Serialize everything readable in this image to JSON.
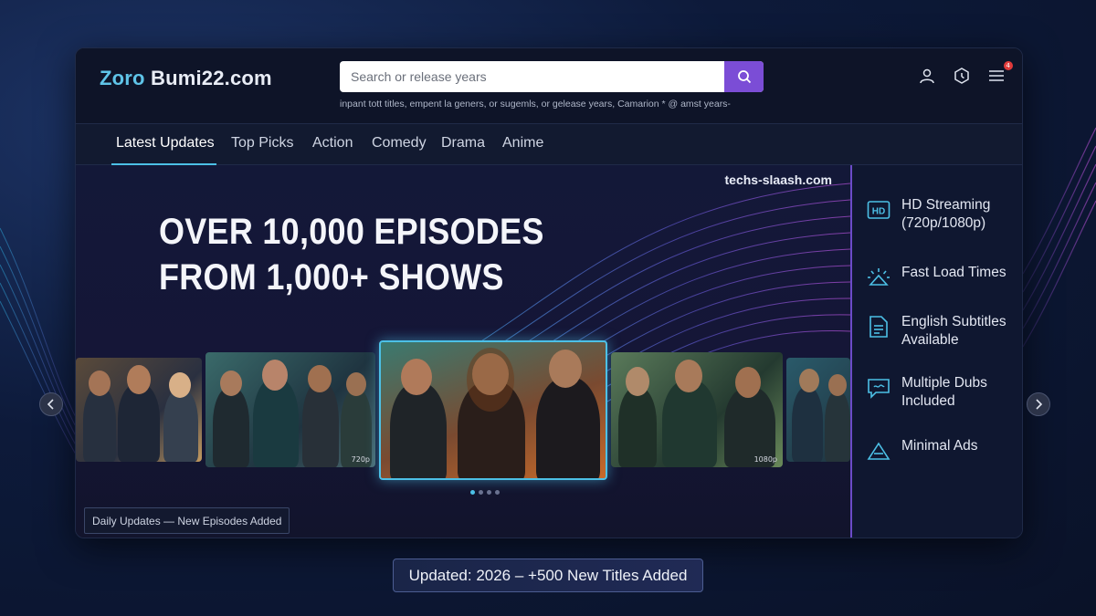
{
  "header": {
    "logo_part1": "Zoro",
    "logo_part2": " Bumi22.com",
    "search_placeholder": "Search or release years",
    "search_hint": "inpant tott titles, empent la geners, or sugemls, or gelease years, Camarion * @ amst years-",
    "notification_count": "4"
  },
  "tabs": [
    {
      "label": "Latest Updates",
      "active": true
    },
    {
      "label": "Top Picks"
    },
    {
      "label": "Action"
    },
    {
      "label": "Comedy"
    },
    {
      "label": "Drama"
    },
    {
      "label": "Anime"
    }
  ],
  "hero": {
    "brand_tag": "techs-slaash.com",
    "headline_line1": "OVER 10,000 EPISODES",
    "headline_line2": "FROM 1,000+ SHOWS",
    "card_quality_1": "720p",
    "card_quality_2": "1080p",
    "daily_badge": "Daily Updates — New Episodes Added",
    "carousel_active_index": 0,
    "carousel_count": 4
  },
  "features": [
    {
      "icon": "hd-icon",
      "label_1": "HD Streaming",
      "label_2": "(720p/1080p)"
    },
    {
      "icon": "speed-icon",
      "label_1": "Fast Load Times",
      "label_2": ""
    },
    {
      "icon": "subtitles-icon",
      "label_1": "English Subtitles",
      "label_2": "Available"
    },
    {
      "icon": "chat-icon",
      "label_1": "Multiple Dubs",
      "label_2": "Included"
    },
    {
      "icon": "warning-icon",
      "label_1": "Minimal Ads",
      "label_2": ""
    }
  ],
  "footer": {
    "update_text": "Updated: 2026 – +500 New Titles Added"
  },
  "colors": {
    "accent_cyan": "#4cc0e6",
    "accent_purple": "#7b4dd6",
    "background": "#0b1530"
  }
}
